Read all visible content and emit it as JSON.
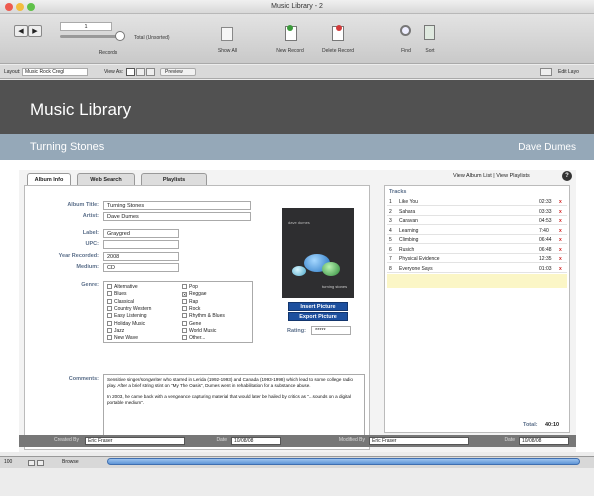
{
  "window": {
    "title": "Music Library - 2"
  },
  "toolbar": {
    "records_label": "Records",
    "total_label": "Total (Unsorted)",
    "record_number": "1",
    "show_all": "Show All",
    "new_record": "New Record",
    "delete_record": "Delete Record",
    "find": "Find",
    "sort": "Sort"
  },
  "layoutbar": {
    "layout_label": "Layout:",
    "layout_value": "Music Rock Cregl",
    "view_as": "View As:",
    "preview": "Preview",
    "edit_layout": "Edit Layo"
  },
  "header": {
    "title": "Music Library"
  },
  "band": {
    "album": "Turning Stones",
    "artist": "Dave Dumes"
  },
  "tabs": [
    {
      "label": "Album Info"
    },
    {
      "label": "Web Search"
    },
    {
      "label": "Playlists"
    }
  ],
  "links": {
    "album_list": "View Album List",
    "separator": "|",
    "playlists": "View Playlists",
    "help": "?"
  },
  "form": {
    "album_title_label": "Album Title:",
    "album_title": "Turning Stones",
    "artist_label": "Artist:",
    "artist": "Dave Dumes",
    "label_label": "Label:",
    "label": "Graygred",
    "upc_label": "UPC:",
    "upc": "",
    "year_label": "Year Recorded:",
    "year": "2008",
    "medium_label": "Medium:",
    "medium": "CD",
    "genre_label": "Genre:",
    "genres_col1": [
      "Alternative",
      "Blues",
      "Classical",
      "Country Western",
      "Easy Listening",
      "Holiday Music",
      "Jazz",
      "New Wave"
    ],
    "genres_col2": [
      "Pop",
      "Reggae",
      "Rap",
      "Rock",
      "Rhythm & Blues",
      "Gene",
      "World Music",
      "Other..."
    ],
    "genres_checked": [
      "Reggae"
    ],
    "insert_picture": "Insert Picture",
    "export_picture": "Export Picture",
    "rating_label": "Rating:",
    "rating": "*****",
    "comments_label": "Comments:",
    "comments_p1": "Sensitive singer/songwriter who starred in Lerida (1992-1993) and Canada (1993-1998) which lead to some college radio play. After a brief string stint on \"My The Oasis\", Dumes went in rehabilitation for a substance abuse.",
    "comments_p2": "In 2003, he came back with a vengeance capturing material that would later be hailed by critics as \"...sounds on a digital portable medium\"."
  },
  "album_art": {
    "caption_top": "dave dumes",
    "caption_bottom": "turning stones"
  },
  "tracks": {
    "header": "Tracks",
    "rows": [
      {
        "n": "1",
        "title": "Like You",
        "time": "02:33"
      },
      {
        "n": "2",
        "title": "Sahara",
        "time": "03:33"
      },
      {
        "n": "3",
        "title": "Caravan",
        "time": "04:53"
      },
      {
        "n": "4",
        "title": "Learning",
        "time": "7:40"
      },
      {
        "n": "5",
        "title": "Climbing",
        "time": "06:44"
      },
      {
        "n": "6",
        "title": "Rusich",
        "time": "06:48"
      },
      {
        "n": "7",
        "title": "Physical Evidence",
        "time": "12:35"
      },
      {
        "n": "8",
        "title": "Everyone Says",
        "time": "01:03"
      }
    ],
    "delete_symbol": "x",
    "total_label": "Total:",
    "total": "40:10"
  },
  "footer": {
    "created_by_label": "Created By",
    "created_by": "Eric Fraser",
    "date_label": "Date",
    "date": "10/08/08",
    "modified_by_label": "Modified By",
    "modified_by": "Eric Fraser",
    "date2_label": "Date",
    "date2": "10/08/08"
  },
  "statusbar": {
    "zoom": "100",
    "mode": "Browse"
  },
  "colors": {
    "header": "#515151",
    "band": "#95a8b8",
    "accent_button": "#1c4f9e",
    "delete": "#d02020"
  }
}
